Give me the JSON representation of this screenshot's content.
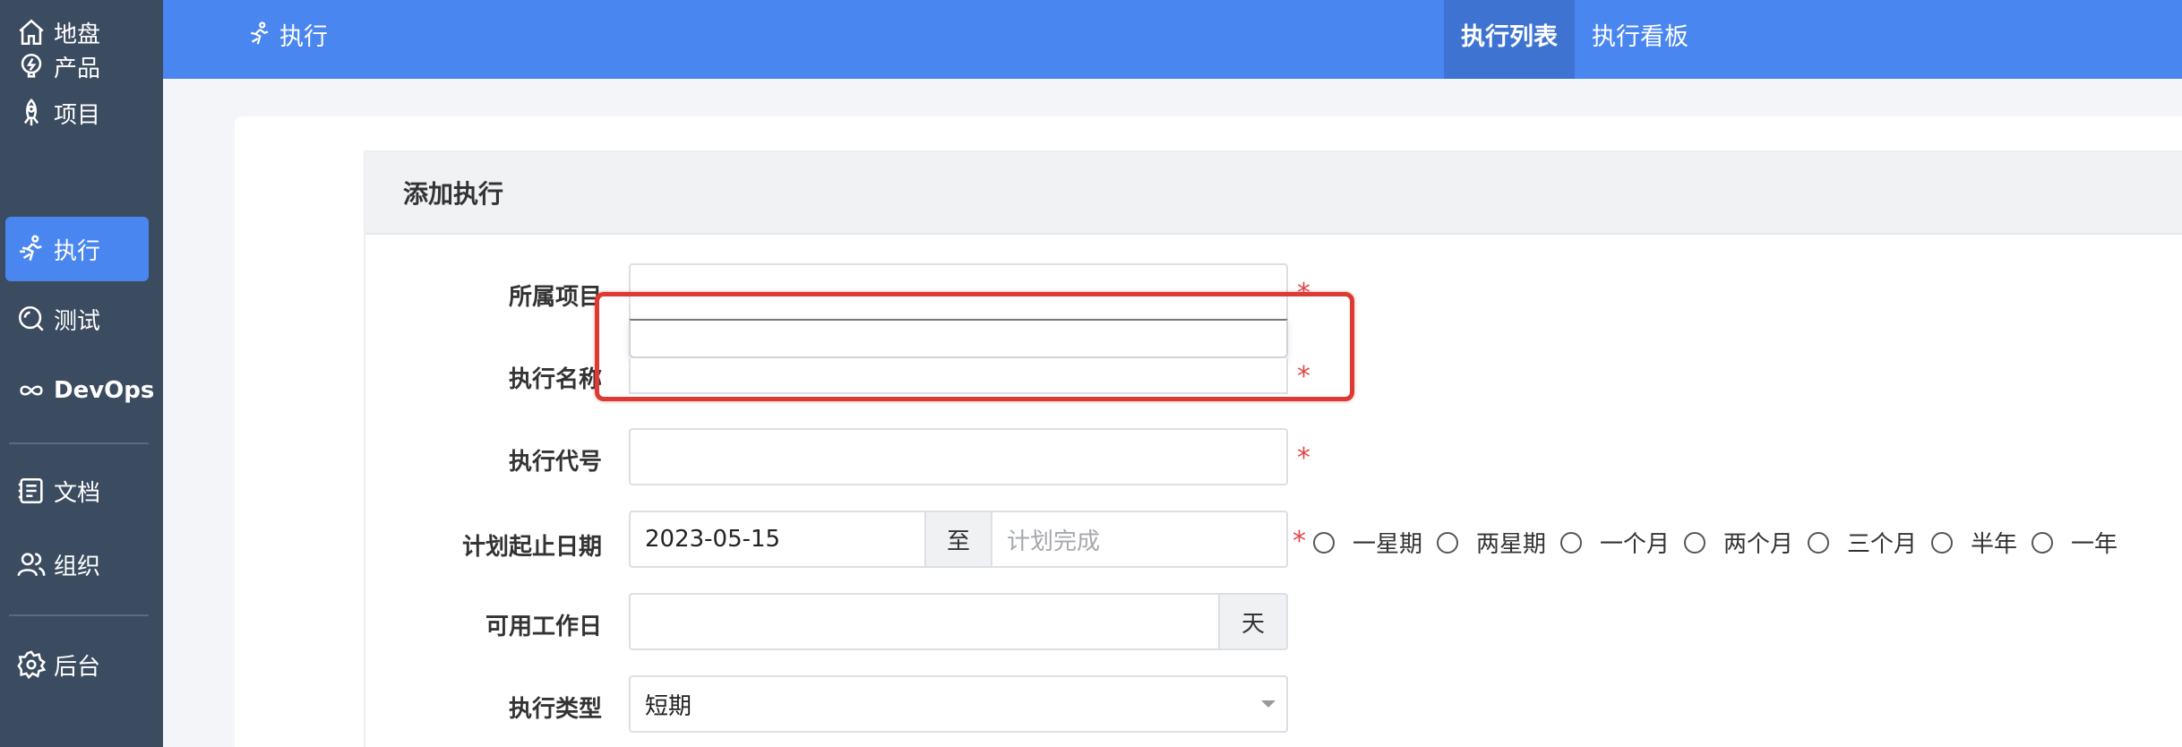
{
  "sidebar": {
    "items": [
      {
        "label": "地盘",
        "icon": "home-icon"
      },
      {
        "label": "产品",
        "icon": "bulb-icon"
      },
      {
        "label": "项目",
        "icon": "rocket-icon"
      },
      {
        "label": "执行",
        "icon": "run-icon"
      },
      {
        "label": "测试",
        "icon": "magnifier-icon"
      },
      {
        "label": "DevOps",
        "icon": "infinity-icon"
      },
      {
        "label": "文档",
        "icon": "document-icon"
      },
      {
        "label": "组织",
        "icon": "users-icon"
      },
      {
        "label": "后台",
        "icon": "gear-icon"
      }
    ],
    "active": "执行"
  },
  "topbar": {
    "title": "执行",
    "tabs": [
      {
        "label": "执行列表",
        "active": true
      },
      {
        "label": "执行看板",
        "active": false
      }
    ]
  },
  "form": {
    "header": "添加执行",
    "project_label": "所属项目",
    "name_label": "执行名称",
    "code_label": "执行代号",
    "dates_label": "计划起止日期",
    "start_date": "2023-05-15",
    "date_separator": "至",
    "end_placeholder": "计划完成",
    "workdays_label": "可用工作日",
    "workdays_unit": "天",
    "type_label": "执行类型",
    "type_value": "短期",
    "required_mark": "*",
    "durations": [
      "一星期",
      "两星期",
      "一个月",
      "两个月",
      "三个月",
      "半年",
      "一年"
    ]
  },
  "colors": {
    "sidebar_bg": "#3b4b60",
    "accent": "#4a86f0",
    "required": "#e04848",
    "highlight": "#dc3a32"
  }
}
